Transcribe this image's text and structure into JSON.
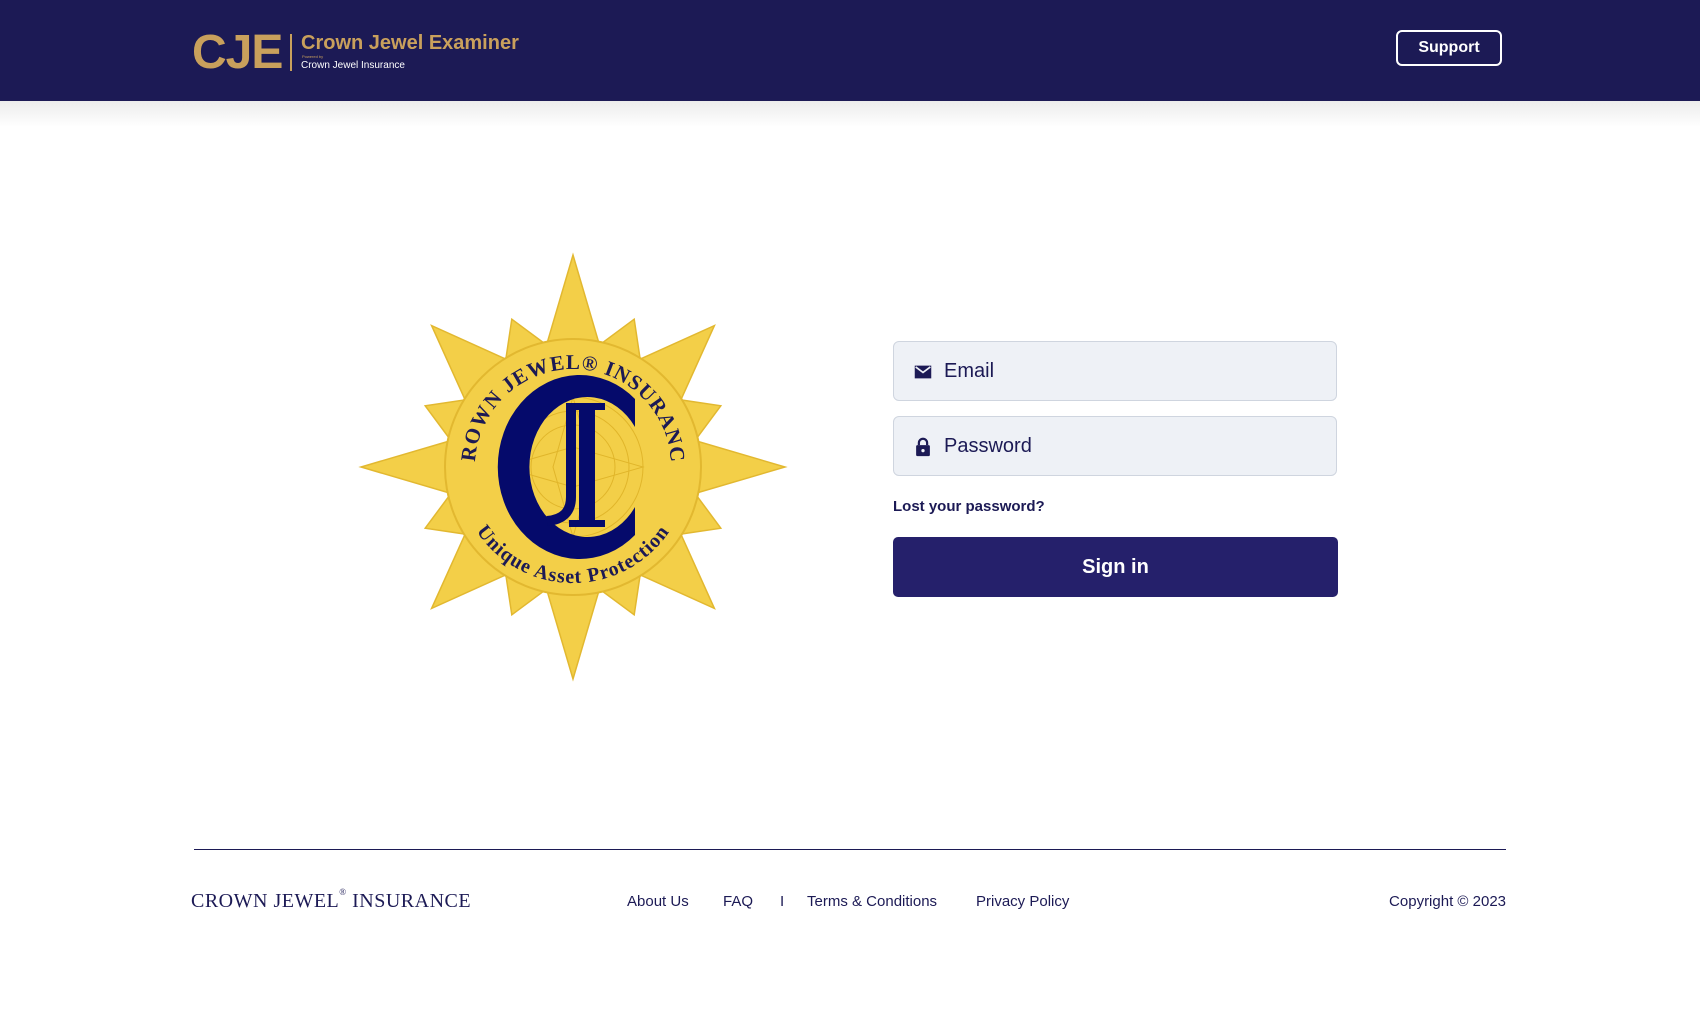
{
  "header": {
    "logo_abbr": "CJE",
    "logo_title": "Crown Jewel Examiner",
    "logo_powered": "Powered by",
    "logo_sub": "Crown Jewel Insurance",
    "support_label": "Support"
  },
  "emblem": {
    "top_text": "CROWN JEWEL® INSURANCE",
    "bottom_text": "Unique Asset Protection",
    "monogram": "CJI"
  },
  "form": {
    "email_placeholder": "Email",
    "password_placeholder": "Password",
    "lost_password": "Lost your password?",
    "signin_label": "Sign in",
    "email_icon": "envelope-icon",
    "password_icon": "lock-icon"
  },
  "footer": {
    "brand_left": "CROWN JEWEL",
    "brand_mark": "®",
    "brand_right": "INSURANCE",
    "links": [
      "About Us",
      "FAQ",
      "Terms & Conditions",
      "Privacy Policy"
    ],
    "separator": "I",
    "copyright": "Copyright © 2023"
  },
  "colors": {
    "navy": "#1c1a55",
    "button": "#25206b",
    "gold": "#c9a05c",
    "emblem_gold": "#f3cf48",
    "field_bg": "#eef1f6"
  }
}
